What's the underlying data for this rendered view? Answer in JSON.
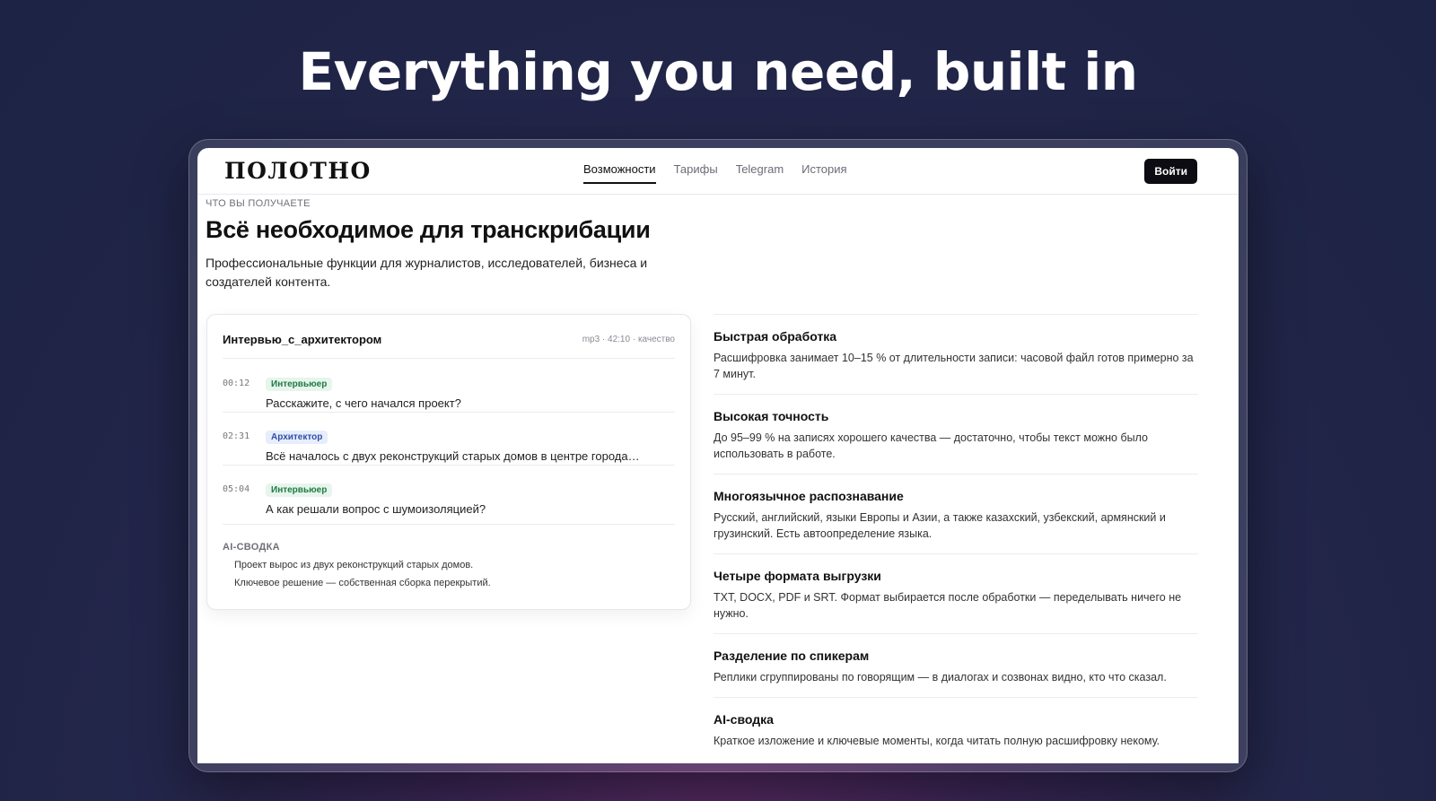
{
  "hero": {
    "title": "Everything you need, built in"
  },
  "nav": {
    "logo": "ПОЛОТНО",
    "links": [
      "Возможности",
      "Тарифы",
      "Telegram",
      "История"
    ],
    "login": "Войти"
  },
  "section": {
    "eyebrow": "ЧТО ВЫ ПОЛУЧАЕТЕ",
    "title": "Всё необходимое для транскрибации",
    "subtitle": "Профессиональные функции для журналистов, исследователей, бизнеса и создателей контента."
  },
  "transcript": {
    "file": "Интервью_с_архитектором",
    "meta": "mp3 · 42:10 · качество",
    "rows": [
      {
        "time": "00:12",
        "speaker": "Интервьюер",
        "text": "Расскажите, с чего начался проект?",
        "badge_color": "#1f7a44"
      },
      {
        "time": "02:31",
        "speaker": "Архитектор",
        "text": "Всё началось с двух реконструкций старых домов в центре города…",
        "badge_color": "#2e4fa8"
      },
      {
        "time": "05:04",
        "speaker": "Интервьюер",
        "text": "А как решали вопрос с шумоизоляцией?",
        "badge_color": "#1f7a44"
      }
    ],
    "summary_label": "AI-СВОДКА",
    "summary_lines": [
      "Проект вырос из двух реконструкций старых домов.",
      "Ключевое решение — собственная сборка перекрытий."
    ]
  },
  "features": [
    {
      "title": "Быстрая обработка",
      "desc": "Расшифровка занимает 10–15 % от длительности записи: часовой файл готов примерно за 7 минут."
    },
    {
      "title": "Высокая точность",
      "desc": "До 95–99 % на записях хорошего качества — достаточно, чтобы текст можно было использовать в работе."
    },
    {
      "title": "Многоязычное распознавание",
      "desc": "Русский, английский, языки Европы и Азии, а также казахский, узбекский, армянский и грузинский. Есть автоопределение языка."
    },
    {
      "title": "Четыре формата выгрузки",
      "desc": "TXT, DOCX, PDF и SRT. Формат выбирается после обработки — переделывать ничего не нужно."
    },
    {
      "title": "Разделение по спикерам",
      "desc": "Реплики сгруппированы по говорящим — в диалогах и созвонах видно, кто что сказал."
    },
    {
      "title": "AI-сводка",
      "desc": "Краткое изложение и ключевые моменты, когда читать полную расшифровку некому."
    }
  ],
  "colors": {
    "background": "#1c2344",
    "accent": "#0c0c12"
  }
}
